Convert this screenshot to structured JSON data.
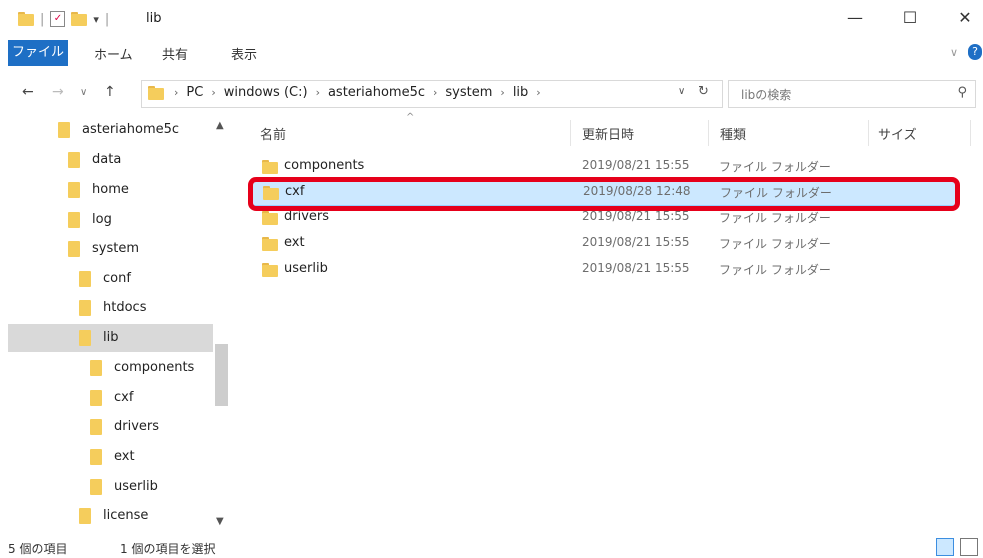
{
  "window": {
    "title": "lib"
  },
  "ribbon": {
    "tabs": [
      "ファイル",
      "ホーム",
      "共有",
      "表示"
    ]
  },
  "address": {
    "crumbs": [
      "PC",
      "windows (C:)",
      "asteriahome5c",
      "system",
      "lib"
    ],
    "search_placeholder": "libの検索"
  },
  "nav": {
    "items": [
      {
        "label": "asteriahome5c",
        "level": 0
      },
      {
        "label": "data",
        "level": 1
      },
      {
        "label": "home",
        "level": 1
      },
      {
        "label": "log",
        "level": 1
      },
      {
        "label": "system",
        "level": 1
      },
      {
        "label": "conf",
        "level": 2
      },
      {
        "label": "htdocs",
        "level": 2
      },
      {
        "label": "lib",
        "level": 2,
        "selected": true
      },
      {
        "label": "components",
        "level": 3
      },
      {
        "label": "cxf",
        "level": 3
      },
      {
        "label": "drivers",
        "level": 3
      },
      {
        "label": "ext",
        "level": 3
      },
      {
        "label": "userlib",
        "level": 3
      },
      {
        "label": "license",
        "level": 2
      }
    ]
  },
  "columns": {
    "name": "名前",
    "date": "更新日時",
    "type": "種類",
    "size": "サイズ"
  },
  "files": [
    {
      "name": "components",
      "date": "2019/08/21 15:55",
      "type": "ファイル フォルダー"
    },
    {
      "name": "cxf",
      "date": "2019/08/28 12:48",
      "type": "ファイル フォルダー",
      "selected": true
    },
    {
      "name": "drivers",
      "date": "2019/08/21 15:55",
      "type": "ファイル フォルダー"
    },
    {
      "name": "ext",
      "date": "2019/08/21 15:55",
      "type": "ファイル フォルダー"
    },
    {
      "name": "userlib",
      "date": "2019/08/21 15:55",
      "type": "ファイル フォルダー"
    }
  ],
  "status": {
    "count": "5 個の項目",
    "selection": "1 個の項目を選択"
  },
  "colors": {
    "accent": "#1e6fc5",
    "selection": "#cce8ff",
    "highlight": "#e6001a"
  }
}
